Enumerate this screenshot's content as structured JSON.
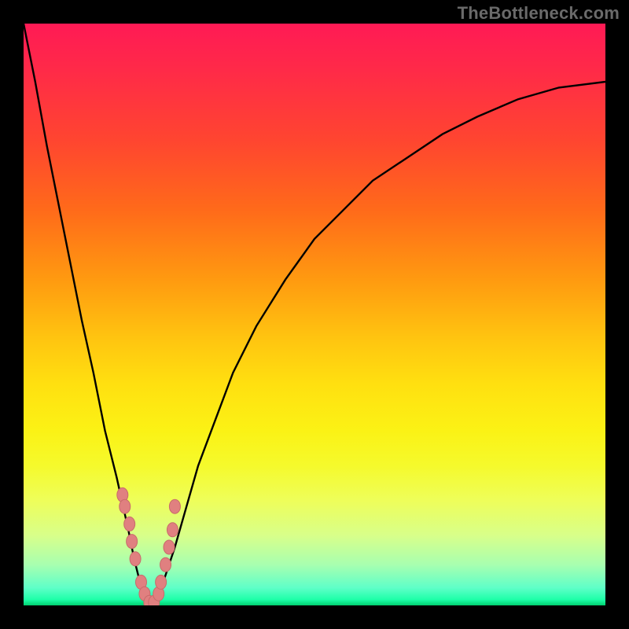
{
  "watermark": "TheBottleneck.com",
  "colors": {
    "bg_frame": "#000000",
    "curve": "#000000",
    "marker_fill": "#e08080",
    "marker_stroke": "#c86a6a",
    "gradient_stops": [
      "#ff1a55",
      "#ff2a48",
      "#ff4530",
      "#ff6a1a",
      "#ff9a10",
      "#ffc410",
      "#ffe010",
      "#fbf215",
      "#f5fa2c",
      "#eefe5a",
      "#d8ff8a",
      "#a8ffb0",
      "#5effc8",
      "#1effa8",
      "#00d070"
    ]
  },
  "chart_data": {
    "type": "line",
    "title": "",
    "xlabel": "",
    "ylabel": "",
    "xlim": [
      0,
      100
    ],
    "ylim": [
      0,
      100
    ],
    "x": [
      0,
      2,
      4,
      6,
      8,
      10,
      12,
      14,
      16,
      18,
      19,
      20,
      21,
      22,
      23,
      24,
      26,
      28,
      30,
      33,
      36,
      40,
      45,
      50,
      55,
      60,
      66,
      72,
      78,
      85,
      92,
      100
    ],
    "y": [
      100,
      90,
      79,
      69,
      59,
      49,
      40,
      30,
      22,
      13,
      8,
      4,
      1,
      0,
      1,
      4,
      10,
      17,
      24,
      32,
      40,
      48,
      56,
      63,
      68,
      73,
      77,
      81,
      84,
      87,
      89,
      90
    ],
    "markers": {
      "x": [
        17.0,
        17.4,
        18.2,
        18.6,
        19.2,
        20.2,
        20.8,
        21.6,
        22.4,
        23.2,
        23.6,
        24.4,
        25.0,
        25.6,
        26.0
      ],
      "y": [
        19,
        17,
        14,
        11,
        8,
        4,
        2,
        0.5,
        0.5,
        2,
        4,
        7,
        10,
        13,
        17
      ]
    }
  }
}
